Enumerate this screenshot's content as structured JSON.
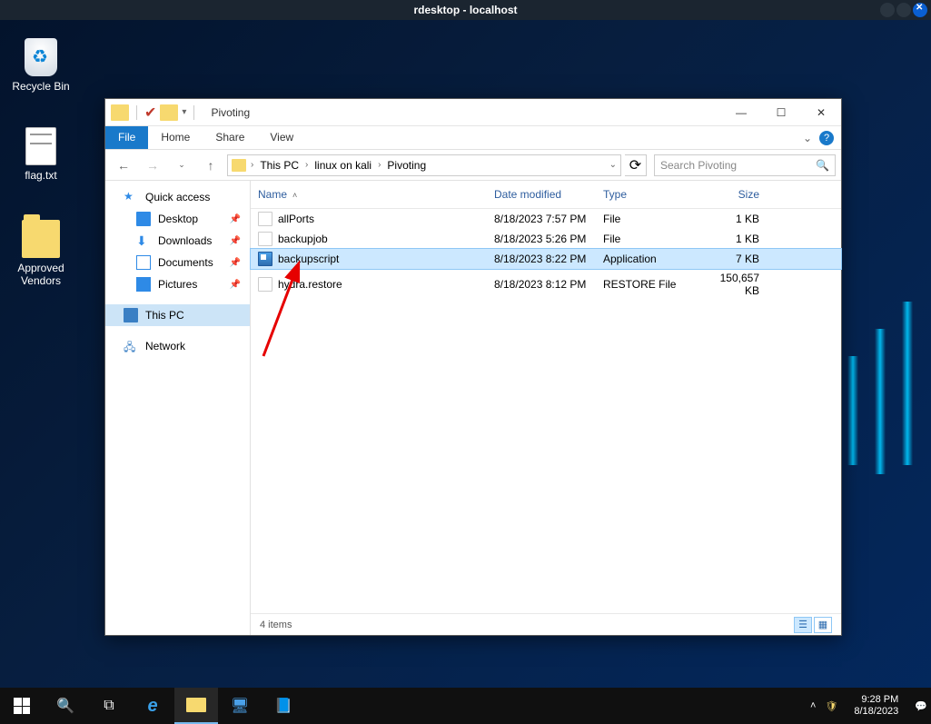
{
  "rdesktop": {
    "title": "rdesktop - localhost"
  },
  "desktopIcons": {
    "recycle": "Recycle Bin",
    "flag": "flag.txt",
    "vendors": "Approved\nVendors"
  },
  "explorer": {
    "title": "Pivoting",
    "tabs": {
      "file": "File",
      "home": "Home",
      "share": "Share",
      "view": "View"
    },
    "breadcrumb": {
      "pc": "This PC",
      "kali": "linux on kali",
      "pivot": "Pivoting"
    },
    "searchPlaceholder": "Search Pivoting",
    "cols": {
      "name": "Name",
      "date": "Date modified",
      "type": "Type",
      "size": "Size"
    },
    "nav": {
      "quick": "Quick access",
      "desktop": "Desktop",
      "downloads": "Downloads",
      "documents": "Documents",
      "pictures": "Pictures",
      "thispc": "This PC",
      "network": "Network"
    },
    "files": [
      {
        "name": "allPorts",
        "date": "8/18/2023 7:57 PM",
        "type": "File",
        "size": "1 KB",
        "icon": "file",
        "sel": false
      },
      {
        "name": "backupjob",
        "date": "8/18/2023 5:26 PM",
        "type": "File",
        "size": "1 KB",
        "icon": "file",
        "sel": false
      },
      {
        "name": "backupscript",
        "date": "8/18/2023 8:22 PM",
        "type": "Application",
        "size": "7 KB",
        "icon": "app",
        "sel": true
      },
      {
        "name": "hydra.restore",
        "date": "8/18/2023 8:12 PM",
        "type": "RESTORE File",
        "size": "150,657 KB",
        "icon": "file",
        "sel": false
      }
    ],
    "status": "4 items"
  },
  "taskbar": {
    "time": "9:28 PM",
    "date": "8/18/2023"
  }
}
